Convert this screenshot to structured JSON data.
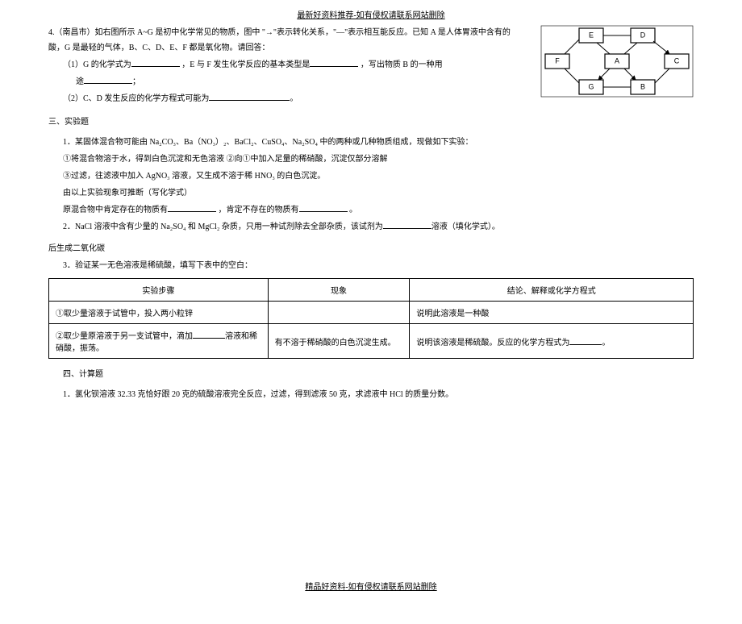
{
  "header": "最新好资料推荐-如有侵权请联系网站删除",
  "footer": "精品好资料-如有侵权请联系网站删除",
  "q4": {
    "intro": "4.（南昌市）如右图所示 A~G 是初中化学常见的物质，图中 \"→\"表示转化关系，\"—\"表示相互能反应。已知 A 是人体胃液中含有的酸，G 是最轻的气体，B、C、D、E、F 都是氧化物。请回答：",
    "p1a": "（1）G 的化学式为",
    "p1b": "，E 与 F 发生化学反应的基本类型是",
    "p1c": "，写出物质 B 的一种用",
    "p1d": "途",
    "p1e": "；",
    "p2a": "（2）C、D 发生反应的化学方程式可能为",
    "p2b": "。"
  },
  "sec3": {
    "title": "三、实验题",
    "q1_intro": "1．某固体混合物可能由 Na₂CO₃、Ba（NO₃）₂、BaCl₂、CuSO₄、Na₂SO₄ 中的两种或几种物质组成，现做如下实验：",
    "step1": "①将混合物溶于水，得到白色沉淀和无色溶液  ②向①中加入足量的稀硝酸，沉淀仅部分溶解",
    "step2": "③过滤，往滤液中加入 AgNO₃ 溶液，又生成不溶于稀 HNO₃ 的白色沉淀。",
    "deduce": "由以上实验现象可推断（写化学式）",
    "d_line_a": "原混合物中肯定存在的物质有",
    "d_line_b": "，肯定不存在的物质有",
    "d_line_c": "。",
    "q2a": "2．NaCl 溶液中含有少量的 Na₂SO₄ 和 MgCl₂ 杂质，只用一种试剂除去全部杂质，该试剂为",
    "q2b": "溶液（填化学式）。",
    "after": "后生成二氧化碳",
    "q3": "3．验证某一无色溶液是稀硫酸，填写下表中的空白："
  },
  "table": {
    "h1": "实验步骤",
    "h2": "现象",
    "h3": "结论、解释或化学方程式",
    "r1c1": "①取少量溶液于试管中，投入两小粒锌",
    "r1c2": "",
    "r1c3": "说明此溶液是一种酸",
    "r2c1a": "②取少量原溶液于另一支试管中，滴加",
    "r2c1b": "溶液和稀硝酸，振荡。",
    "r2c2": "有不溶于稀硝酸的白色沉淀生成。",
    "r2c3a": "说明该溶液是稀硫酸。反应的化学方程式为",
    "r2c3b": "。"
  },
  "sec4": {
    "title": "四、计算题",
    "q1": "1．氯化钡溶液 32.33 克恰好跟 20 克的硫酸溶液完全反应，过滤，得到滤液 50 克，求滤液中 HCl 的质量分数。"
  },
  "diagram": {
    "A": "A",
    "B": "B",
    "C": "C",
    "D": "D",
    "E": "E",
    "F": "F",
    "G": "G"
  }
}
